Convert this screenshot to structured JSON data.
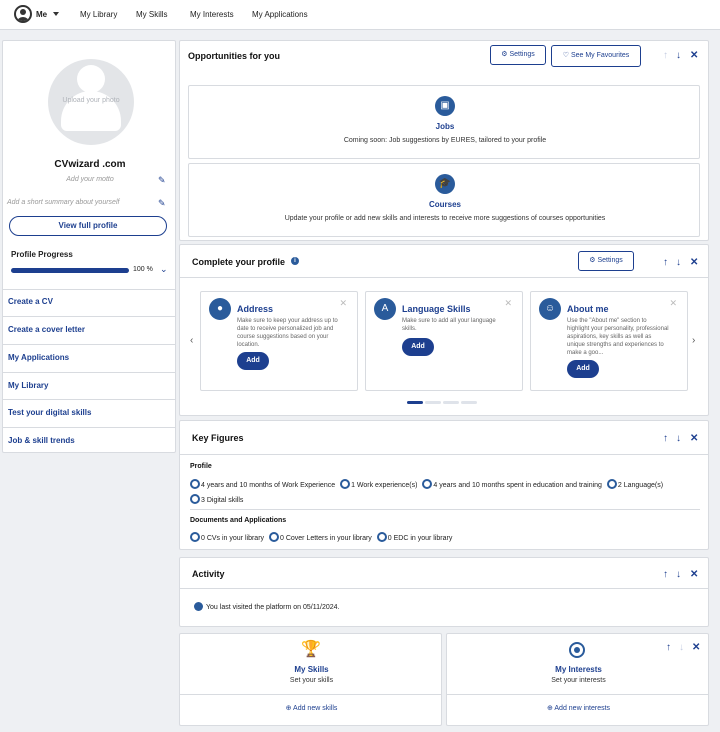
{
  "topnav": {
    "me": "Me",
    "items": [
      "My Library",
      "My Skills",
      "My Interests",
      "My Applications"
    ]
  },
  "profile": {
    "upload_photo": "Upload your photo",
    "name": "CVwizard .com",
    "motto_placeholder": "Add your motto",
    "summary_placeholder": "Add a short summary about yourself",
    "view_full_profile": "View full profile",
    "progress_label": "Profile Progress",
    "progress_value": 100,
    "progress_text": "100 %"
  },
  "left_links": [
    "Create a CV",
    "Create a cover letter",
    "My Applications",
    "My Library",
    "Test your digital skills",
    "Job & skill trends"
  ],
  "opportunities": {
    "title": "Opportunities for you",
    "settings": "Settings",
    "favourites": "See My Favourites",
    "jobs_title": "Jobs",
    "jobs_text": "Coming soon: Job suggestions by EURES, tailored to your profile",
    "courses_title": "Courses",
    "courses_text": "Update your profile or add new skills and interests to receive more suggestions of courses opportunities"
  },
  "complete_profile": {
    "title": "Complete your profile",
    "settings": "Settings",
    "cards": [
      {
        "title": "Address",
        "desc": "Make sure to keep your address up to date to receive personalized job and course suggestions based on your location.",
        "button": "Add",
        "icon": "location-pin-icon"
      },
      {
        "title": "Language Skills",
        "desc": "Make sure to add all your language skills.",
        "button": "Add",
        "icon": "language-icon"
      },
      {
        "title": "About me",
        "desc": "Use the \"About me\" section to highlight your personality, professional aspirations, key skills as well as unique strengths and experiences to make a goo...",
        "button": "Add",
        "icon": "person-edit-icon"
      }
    ]
  },
  "key_figures": {
    "title": "Key Figures",
    "profile_label": "Profile",
    "profile_items": [
      "4 years and 10 months of Work Experience",
      "1 Work experience(s)",
      "4 years and 10 months spent in education and training",
      "2 Language(s)",
      "3 Digital skills"
    ],
    "docs_label": "Documents and Applications",
    "docs_items": [
      "0 CVs in your library",
      "0 Cover Letters in your library",
      "0 EDC in your library"
    ]
  },
  "activity": {
    "title": "Activity",
    "text": "You last visited the platform on 05/11/2024."
  },
  "skills": {
    "title": "My Skills",
    "subtitle": "Set your skills",
    "action": "Add new skills"
  },
  "interests": {
    "title": "My Interests",
    "subtitle": "Set your interests",
    "action": "Add new interests"
  },
  "colors": {
    "primary": "#1d3f8f",
    "icon": "#2a5b9b",
    "background": "#eef0f3"
  }
}
